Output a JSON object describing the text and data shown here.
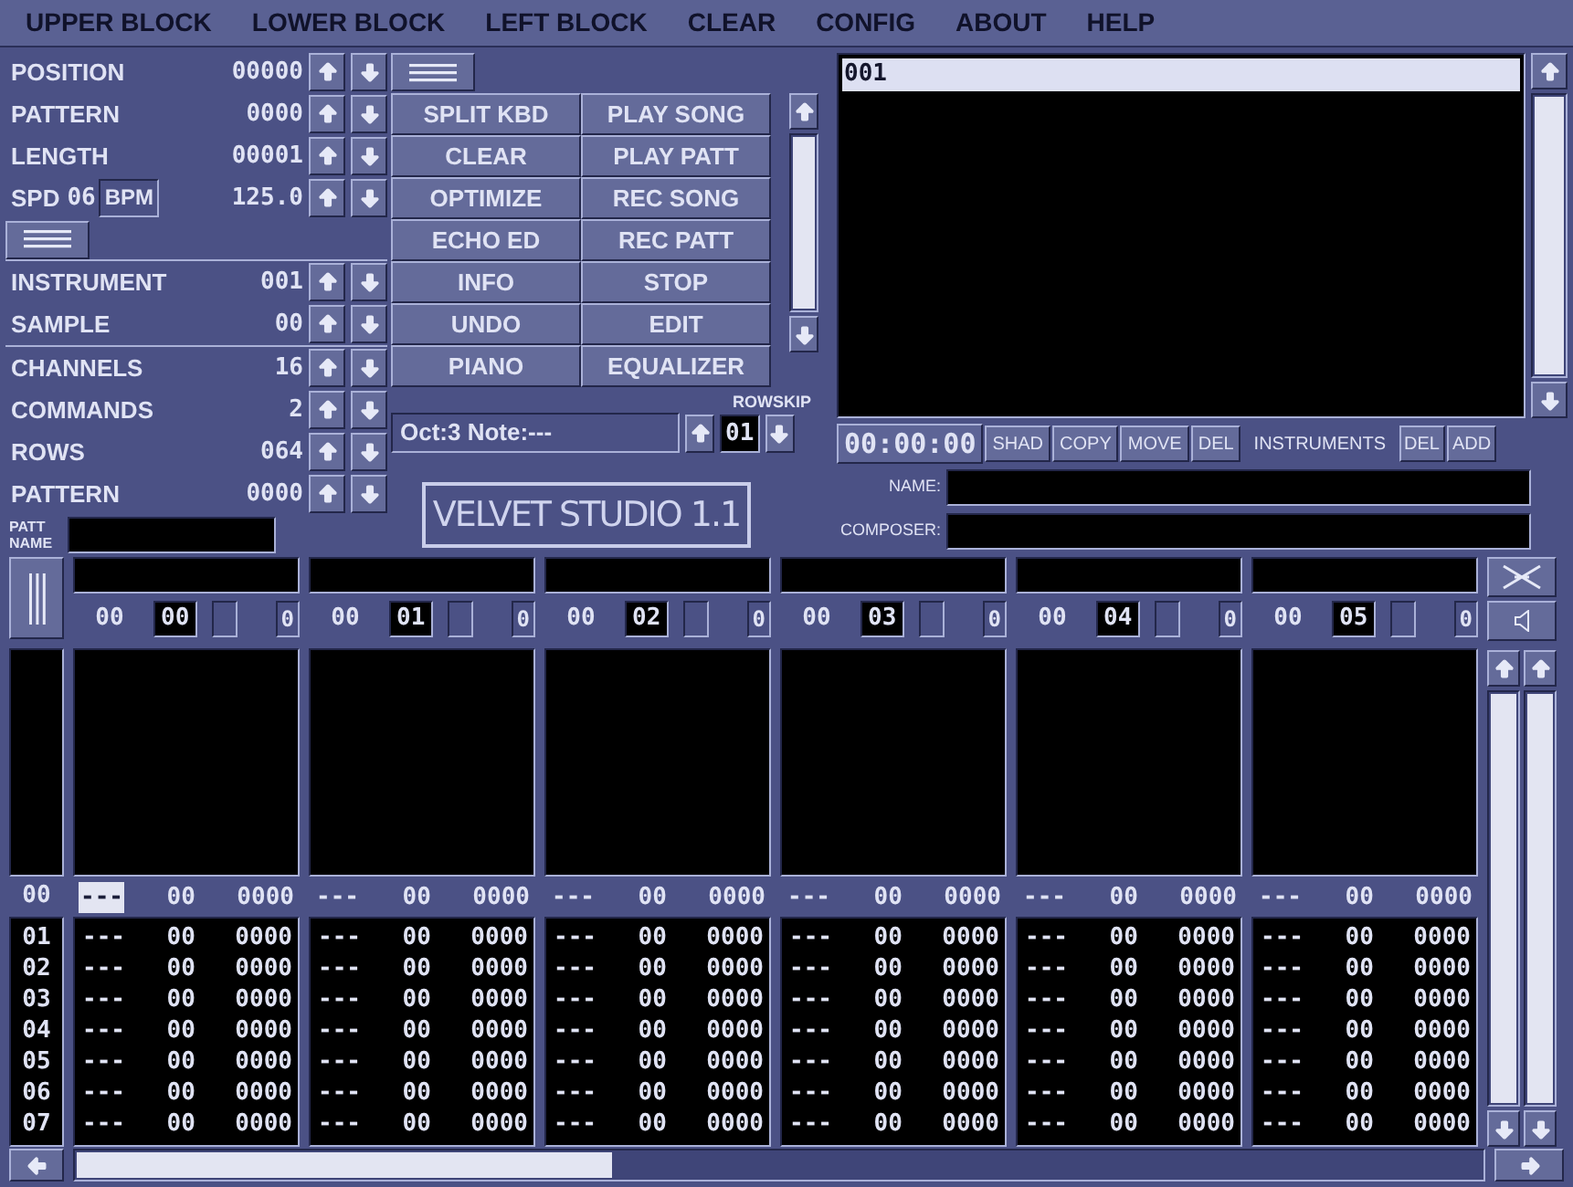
{
  "menu": [
    "UPPER BLOCK",
    "LOWER BLOCK",
    "LEFT BLOCK",
    "CLEAR",
    "CONFIG",
    "ABOUT",
    "HELP"
  ],
  "param_groups": [
    [
      {
        "kind": "counter",
        "label": "POSITION",
        "value": "00000"
      },
      {
        "kind": "counter",
        "label": "PATTERN",
        "value": "0000"
      },
      {
        "kind": "counter",
        "label": "LENGTH",
        "value": "00001"
      },
      {
        "kind": "tempo",
        "label": "SPD",
        "value": "06",
        "unit": "BPM",
        "bpm": "125.0"
      }
    ],
    [
      {
        "kind": "counter",
        "label": "INSTRUMENT",
        "value": "001"
      },
      {
        "kind": "counter",
        "label": "SAMPLE",
        "value": "00"
      }
    ],
    [
      {
        "kind": "counter",
        "label": "CHANNELS",
        "value": "16"
      },
      {
        "kind": "counter",
        "label": "COMMANDS",
        "value": "2"
      },
      {
        "kind": "counter",
        "label": "ROWS",
        "value": "064"
      },
      {
        "kind": "counter",
        "label": "PATTERN",
        "value": "0000"
      }
    ]
  ],
  "pattern_name": {
    "label": "PATT NAME"
  },
  "function_buttons": [
    "SPLIT KBD",
    "PLAY SONG",
    "CLEAR",
    "PLAY PATT",
    "OPTIMIZE",
    "REC SONG",
    "ECHO ED",
    "REC PATT",
    "INFO",
    "STOP",
    "UNDO",
    "EDIT",
    "PIANO",
    "EQUALIZER"
  ],
  "note_field": "Oct:3 Note:---",
  "rowskip": {
    "label": "ROWSKIP",
    "value": "01"
  },
  "logo": "VELVET STUDIO 1.1",
  "instrument_list": [
    {
      "text": "001",
      "selected": true
    }
  ],
  "timer": "00:00:00",
  "edit_buttons": [
    "SHAD",
    "COPY",
    "MOVE",
    "DEL"
  ],
  "instruments_label": "INSTRUMENTS",
  "instrument_buttons": [
    "DEL",
    "ADD"
  ],
  "song_fields": [
    {
      "label": "NAME:"
    },
    {
      "label": "COMPOSER:"
    }
  ],
  "channels": [
    {
      "column_1": "00",
      "number": "00",
      "column_3": "0"
    },
    {
      "column_1": "00",
      "number": "01",
      "column_3": "0"
    },
    {
      "column_1": "00",
      "number": "02",
      "column_3": "0"
    },
    {
      "column_1": "00",
      "number": "03",
      "column_3": "0"
    },
    {
      "column_1": "00",
      "number": "04",
      "column_3": "0"
    },
    {
      "column_1": "00",
      "number": "05",
      "column_3": "0"
    }
  ],
  "current_row": {
    "row": "00",
    "cells": [
      {
        "note": "---",
        "instrument": "00",
        "effect": "0000",
        "selected": true
      },
      {
        "note": "---",
        "instrument": "00",
        "effect": "0000",
        "selected": false
      },
      {
        "note": "---",
        "instrument": "00",
        "effect": "0000",
        "selected": false
      },
      {
        "note": "---",
        "instrument": "00",
        "effect": "0000",
        "selected": false
      },
      {
        "note": "---",
        "instrument": "00",
        "effect": "0000",
        "selected": false
      },
      {
        "note": "---",
        "instrument": "00",
        "effect": "0000",
        "selected": false
      }
    ]
  },
  "rows": [
    {
      "row": "01",
      "cells": [
        {
          "note": "---",
          "instrument": "00",
          "effect": "0000"
        },
        {
          "note": "---",
          "instrument": "00",
          "effect": "0000"
        },
        {
          "note": "---",
          "instrument": "00",
          "effect": "0000"
        },
        {
          "note": "---",
          "instrument": "00",
          "effect": "0000"
        },
        {
          "note": "---",
          "instrument": "00",
          "effect": "0000"
        },
        {
          "note": "---",
          "instrument": "00",
          "effect": "0000"
        }
      ]
    },
    {
      "row": "02",
      "cells": [
        {
          "note": "---",
          "instrument": "00",
          "effect": "0000"
        },
        {
          "note": "---",
          "instrument": "00",
          "effect": "0000"
        },
        {
          "note": "---",
          "instrument": "00",
          "effect": "0000"
        },
        {
          "note": "---",
          "instrument": "00",
          "effect": "0000"
        },
        {
          "note": "---",
          "instrument": "00",
          "effect": "0000"
        },
        {
          "note": "---",
          "instrument": "00",
          "effect": "0000"
        }
      ]
    },
    {
      "row": "03",
      "cells": [
        {
          "note": "---",
          "instrument": "00",
          "effect": "0000"
        },
        {
          "note": "---",
          "instrument": "00",
          "effect": "0000"
        },
        {
          "note": "---",
          "instrument": "00",
          "effect": "0000"
        },
        {
          "note": "---",
          "instrument": "00",
          "effect": "0000"
        },
        {
          "note": "---",
          "instrument": "00",
          "effect": "0000"
        },
        {
          "note": "---",
          "instrument": "00",
          "effect": "0000"
        }
      ]
    },
    {
      "row": "04",
      "cells": [
        {
          "note": "---",
          "instrument": "00",
          "effect": "0000"
        },
        {
          "note": "---",
          "instrument": "00",
          "effect": "0000"
        },
        {
          "note": "---",
          "instrument": "00",
          "effect": "0000"
        },
        {
          "note": "---",
          "instrument": "00",
          "effect": "0000"
        },
        {
          "note": "---",
          "instrument": "00",
          "effect": "0000"
        },
        {
          "note": "---",
          "instrument": "00",
          "effect": "0000"
        }
      ]
    },
    {
      "row": "05",
      "cells": [
        {
          "note": "---",
          "instrument": "00",
          "effect": "0000"
        },
        {
          "note": "---",
          "instrument": "00",
          "effect": "0000"
        },
        {
          "note": "---",
          "instrument": "00",
          "effect": "0000"
        },
        {
          "note": "---",
          "instrument": "00",
          "effect": "0000"
        },
        {
          "note": "---",
          "instrument": "00",
          "effect": "0000"
        },
        {
          "note": "---",
          "instrument": "00",
          "effect": "0000"
        }
      ]
    },
    {
      "row": "06",
      "cells": [
        {
          "note": "---",
          "instrument": "00",
          "effect": "0000"
        },
        {
          "note": "---",
          "instrument": "00",
          "effect": "0000"
        },
        {
          "note": "---",
          "instrument": "00",
          "effect": "0000"
        },
        {
          "note": "---",
          "instrument": "00",
          "effect": "0000"
        },
        {
          "note": "---",
          "instrument": "00",
          "effect": "0000"
        },
        {
          "note": "---",
          "instrument": "00",
          "effect": "0000"
        }
      ]
    },
    {
      "row": "07",
      "cells": [
        {
          "note": "---",
          "instrument": "00",
          "effect": "0000"
        },
        {
          "note": "---",
          "instrument": "00",
          "effect": "0000"
        },
        {
          "note": "---",
          "instrument": "00",
          "effect": "0000"
        },
        {
          "note": "---",
          "instrument": "00",
          "effect": "0000"
        },
        {
          "note": "---",
          "instrument": "00",
          "effect": "0000"
        },
        {
          "note": "---",
          "instrument": "00",
          "effect": "0000"
        }
      ]
    }
  ]
}
